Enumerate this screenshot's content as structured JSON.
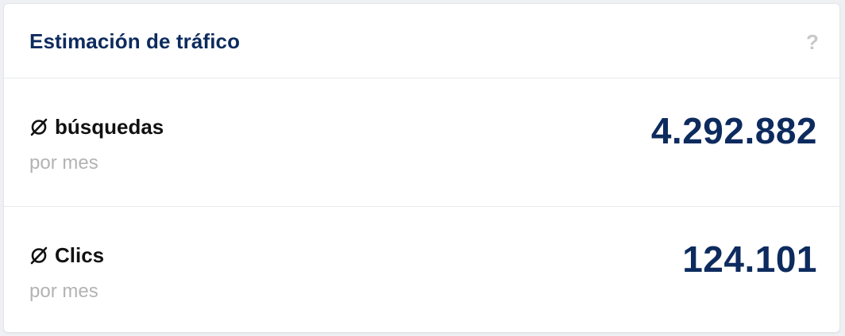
{
  "card": {
    "title": "Estimación de tráfico",
    "help_glyph": "?"
  },
  "metrics": [
    {
      "icon": "average-icon",
      "label": "búsquedas",
      "sublabel": "por mes",
      "value": "4.292.882"
    },
    {
      "icon": "average-icon",
      "label": "Clics",
      "sublabel": "por mes",
      "value": "124.101"
    }
  ],
  "colors": {
    "title": "#0d2b5e",
    "value": "#0d2b5e",
    "label": "#111111",
    "sublabel": "#b3b3b3",
    "help_icon": "#c8c8c8"
  }
}
